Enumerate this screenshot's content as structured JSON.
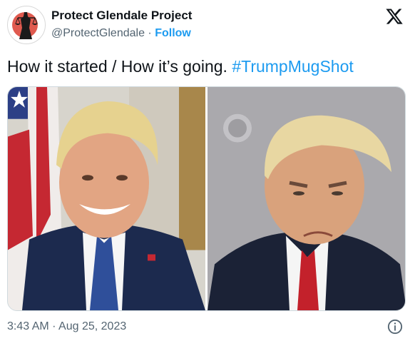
{
  "author": {
    "display_name": "Protect Glendale Project",
    "handle": "@ProtectGlendale",
    "separator": " · ",
    "follow_label": "Follow",
    "avatar_icon": "lady-justice-logo"
  },
  "brand_icon": "x-logo-icon",
  "tweet": {
    "text": "How it started / How it’s going. ",
    "hashtag": "#TrumpMugShot"
  },
  "media": {
    "left_photo": "portrait-photo",
    "right_photo": "mugshot-photo"
  },
  "footer": {
    "timestamp": "3:43 AM · Aug 25, 2023",
    "info_icon": "info-icon"
  },
  "colors": {
    "accent": "#1d9bf0",
    "text": "#0f1419",
    "muted": "#536471",
    "avatar_red": "#e05a4f"
  }
}
